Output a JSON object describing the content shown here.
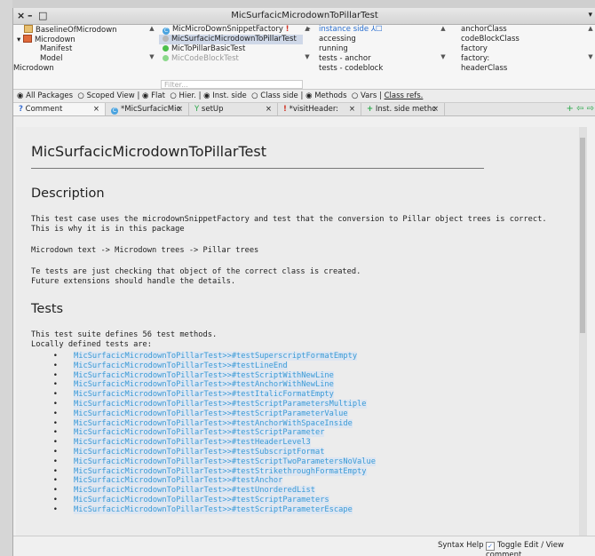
{
  "window": {
    "title": "MicSurfacicMicrodownToPillarTest",
    "controls": [
      "×",
      "–",
      "□"
    ],
    "menu_glyph": "▾"
  },
  "packages": {
    "items": [
      {
        "label": "BaselineOfMicrodown",
        "indent": 1,
        "icon": "package-icon"
      },
      {
        "label": "Microdown",
        "indent": 0,
        "icon": "package-icon",
        "expanded": true
      },
      {
        "label": "Manifest",
        "indent": 2
      },
      {
        "label": "Model",
        "indent": 2
      },
      {
        "label": "Microdown",
        "indent": 0
      }
    ]
  },
  "classes": {
    "items": [
      {
        "label": "MicMicroDownSnippetFactory",
        "icon": "class-c-icon",
        "flag": "!"
      },
      {
        "label": "MicSurfacicMicrodownToPillarTest",
        "icon": "grey-dot",
        "selected": true
      },
      {
        "label": "MicToPillarBasicTest",
        "icon": "green-dot"
      },
      {
        "label": "MicCodeBlockTest",
        "icon": "green-dot-faded"
      }
    ],
    "filter_placeholder": "Filter..."
  },
  "protocols": {
    "items": [
      "instance side",
      "accessing",
      "running",
      "tests - anchor",
      "tests - codeblock"
    ]
  },
  "methods": {
    "items": [
      "anchorClass",
      "codeBlockClass",
      "factory",
      "factory:",
      "headerClass"
    ]
  },
  "options": {
    "all_packages": "All Packages",
    "scoped_view": "Scoped View",
    "flat": "Flat",
    "hier": "Hier.",
    "inst_side": "Inst. side",
    "class_side": "Class side",
    "methods": "Methods",
    "vars": "Vars",
    "class_refs": "Class refs."
  },
  "tabs": [
    {
      "label": "Comment",
      "icon": "?",
      "active": true
    },
    {
      "label": "*MicSurfacicMic",
      "icon": "C"
    },
    {
      "label": "setUp",
      "icon": "Y"
    },
    {
      "label": "*visitHeader:",
      "icon": "!"
    },
    {
      "label": "Inst. side methc",
      "icon": "+"
    }
  ],
  "doc": {
    "title": "MicSurfacicMicrodownToPillarTest",
    "description_heading": "Description",
    "desc_p1": "This test case uses the microdownSnippetFactory and test that the conversion to Pillar object trees is correct.\nThis is why it is in this package",
    "desc_p2": "Microdown text -> Microdown trees -> Pillar trees",
    "desc_p3": "Te tests are just checking that object of the correct class is created.\nFuture extensions should handle the details.",
    "tests_heading": "Tests",
    "tests_p": "This test suite defines 56 test methods.\nLocally defined tests are:",
    "bullet": "•",
    "tests": [
      "MicSurfacicMicrodownToPillarTest>>#testSuperscriptFormatEmpty",
      "MicSurfacicMicrodownToPillarTest>>#testLineEnd",
      "MicSurfacicMicrodownToPillarTest>>#testScriptWithNewLine",
      "MicSurfacicMicrodownToPillarTest>>#testAnchorWithNewLine",
      "MicSurfacicMicrodownToPillarTest>>#testItalicFormatEmpty",
      "MicSurfacicMicrodownToPillarTest>>#testScriptParametersMultiple",
      "MicSurfacicMicrodownToPillarTest>>#testScriptParameterValue",
      "MicSurfacicMicrodownToPillarTest>>#testAnchorWithSpaceInside",
      "MicSurfacicMicrodownToPillarTest>>#testScriptParameter",
      "MicSurfacicMicrodownToPillarTest>>#testHeaderLevel3",
      "MicSurfacicMicrodownToPillarTest>>#testSubscriptFormat",
      "MicSurfacicMicrodownToPillarTest>>#testScriptTwoParametersNoValue",
      "MicSurfacicMicrodownToPillarTest>>#testStrikethroughFormatEmpty",
      "MicSurfacicMicrodownToPillarTest>>#testAnchor",
      "MicSurfacicMicrodownToPillarTest>>#testUnorderedList",
      "MicSurfacicMicrodownToPillarTest>>#testScriptParameters",
      "MicSurfacicMicrodownToPillarTest>>#testScriptParameterEscape"
    ]
  },
  "footer": {
    "syntax_help": "Syntax Help",
    "toggle_label": "Toggle Edit / View comment"
  }
}
